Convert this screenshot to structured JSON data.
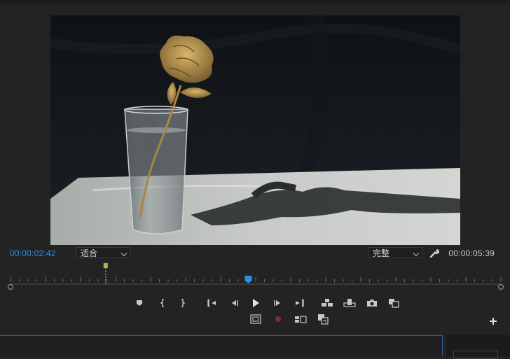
{
  "window": {
    "title": ""
  },
  "program_monitor": {
    "current_timecode": "00:00:02:42",
    "duration_timecode": "00:00:05:39",
    "fit_label": "适合",
    "quality_label": "完整"
  },
  "timeline": {
    "playhead_fraction": 0.485,
    "in_marker_fraction": 0.194
  },
  "icons": [
    "add-marker-icon",
    "mark-in-icon",
    "mark-out-icon",
    "go-to-in-icon",
    "step-back-icon",
    "play-icon",
    "step-forward-icon",
    "go-to-out-icon",
    "insert-icon",
    "overwrite-icon",
    "export-frame-icon",
    "comparison-view-icon",
    "safe-margins-icon",
    "record-icon",
    "multi-camera-icon",
    "vr-video-icon",
    "settings-wrench-icon",
    "add-button-icon"
  ],
  "colors": {
    "accent": "#2d8ceb",
    "in_marker": "#b8b04a",
    "panel": "#232323"
  }
}
